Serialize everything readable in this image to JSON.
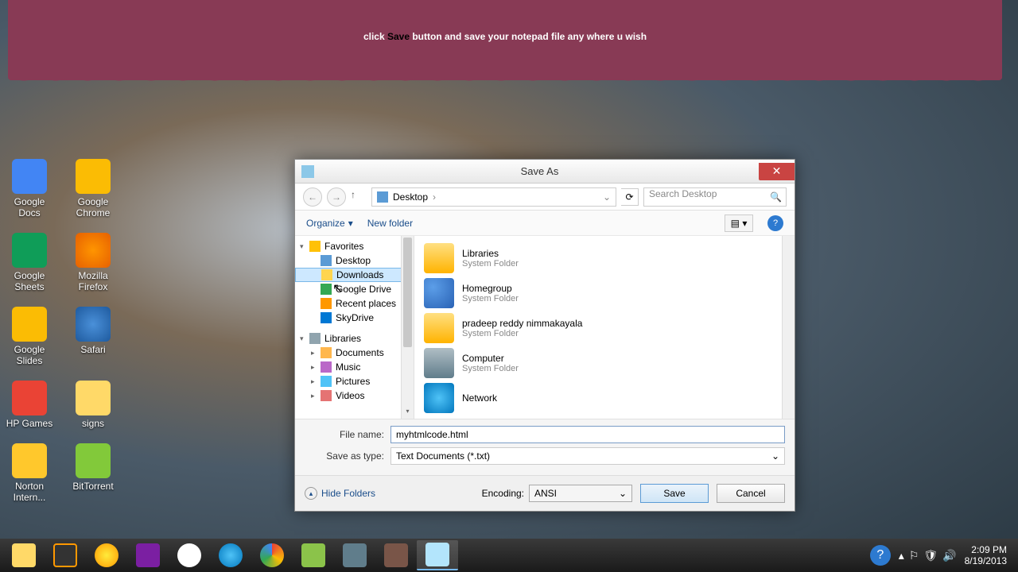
{
  "instruction": {
    "prefix": "click ",
    "save": "Save",
    "suffix": " button and save your notepad file any where u wish"
  },
  "desktop_icons": [
    [
      {
        "n": "Google Docs",
        "c": "blue"
      },
      {
        "n": "Google Chrome",
        "c": "yel"
      }
    ],
    [
      {
        "n": "Google Sheets",
        "c": "grn"
      },
      {
        "n": "Mozilla Firefox",
        "c": "ffx"
      }
    ],
    [
      {
        "n": "Google Slides",
        "c": "yel"
      },
      {
        "n": "Safari",
        "c": "saf"
      }
    ],
    [
      {
        "n": "HP Games",
        "c": "red"
      },
      {
        "n": "signs",
        "c": "fold"
      }
    ],
    [
      {
        "n": "Norton Intern...",
        "c": "nrt"
      },
      {
        "n": "BitTorrent",
        "c": "bit"
      }
    ]
  ],
  "dialog": {
    "title": "Save As",
    "breadcrumb": "Desktop",
    "search_placeholder": "Search Desktop",
    "organize": "Organize",
    "newfolder": "New folder",
    "tree": {
      "favorites": "Favorites",
      "fav_items": [
        {
          "n": "Desktop",
          "c": "dsk"
        },
        {
          "n": "Downloads",
          "c": "dl",
          "sel": true
        },
        {
          "n": "Google Drive",
          "c": "gd"
        },
        {
          "n": "Recent places",
          "c": "rp"
        },
        {
          "n": "SkyDrive",
          "c": "sky"
        }
      ],
      "libraries": "Libraries",
      "lib_items": [
        {
          "n": "Documents",
          "c": "doc"
        },
        {
          "n": "Music",
          "c": "mus"
        },
        {
          "n": "Pictures",
          "c": "pic"
        },
        {
          "n": "Videos",
          "c": "vid"
        }
      ]
    },
    "files": [
      {
        "n": "Libraries",
        "t": "System Folder",
        "c": "lib-ic"
      },
      {
        "n": "Homegroup",
        "t": "System Folder",
        "c": "hg-ic"
      },
      {
        "n": "pradeep reddy nimmakayala",
        "t": "System Folder",
        "c": "usr-ic"
      },
      {
        "n": "Computer",
        "t": "System Folder",
        "c": "cmp-ic"
      },
      {
        "n": "Network",
        "t": "",
        "c": "net-ic"
      }
    ],
    "filename_label": "File name:",
    "filename": "myhtmlcode.html",
    "saveas_label": "Save as type:",
    "saveas": "Text Documents (*.txt)",
    "hide": "Hide Folders",
    "encoding_label": "Encoding:",
    "encoding": "ANSI",
    "save_btn": "Save",
    "cancel_btn": "Cancel"
  },
  "tray": {
    "time": "2:09 PM",
    "date": "8/19/2013"
  }
}
